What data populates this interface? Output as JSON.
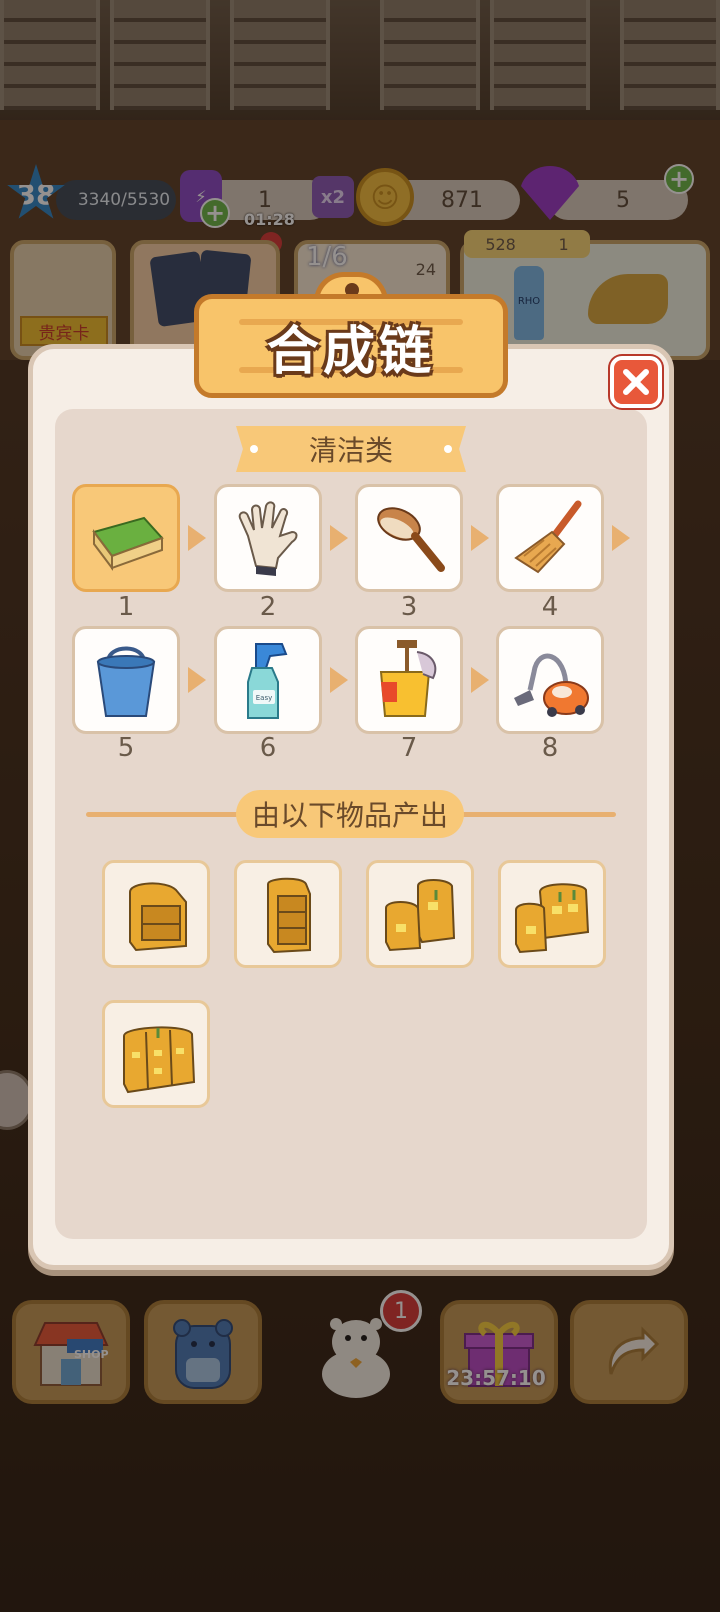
{
  "hud": {
    "level": "38",
    "xp": "3340/5530",
    "energy": "1",
    "energy_timer": "01:28",
    "energy_multiplier": "x2",
    "coins": "871",
    "gems": "5"
  },
  "top_cards": {
    "vip_card_label": "贵宾卡",
    "order_progress": "1/6",
    "order_reward": "24",
    "shelf_coin_cost": "528",
    "shelf_ticket_count": "1",
    "drink_brand": "RHO"
  },
  "modal": {
    "title": "合成链",
    "category": "清洁类",
    "chain": [
      {
        "num": "1",
        "icon": "sponge-icon"
      },
      {
        "num": "2",
        "icon": "glove-icon"
      },
      {
        "num": "3",
        "icon": "brush-icon"
      },
      {
        "num": "4",
        "icon": "broom-icon"
      },
      {
        "num": "5",
        "icon": "bucket-icon"
      },
      {
        "num": "6",
        "icon": "spray-bottle-icon"
      },
      {
        "num": "7",
        "icon": "mop-bucket-icon"
      },
      {
        "num": "8",
        "icon": "vacuum-cleaner-icon"
      }
    ],
    "spray_label": "Easy",
    "sources_title": "由以下物品产出",
    "sources": [
      {
        "icon": "small-shelf-icon"
      },
      {
        "icon": "tall-shelf-icon"
      },
      {
        "icon": "double-shelf-icon"
      },
      {
        "icon": "wide-shelf-icon"
      },
      {
        "icon": "cabinet-shelf-icon"
      }
    ]
  },
  "bottom_bar": {
    "shop_label": "SHOP",
    "notification_count": "1",
    "gift_timer": "23:57:10"
  },
  "colors": {
    "accent": "#f8c878",
    "title_outline": "#6a3a1a",
    "close": "#e8583a"
  }
}
